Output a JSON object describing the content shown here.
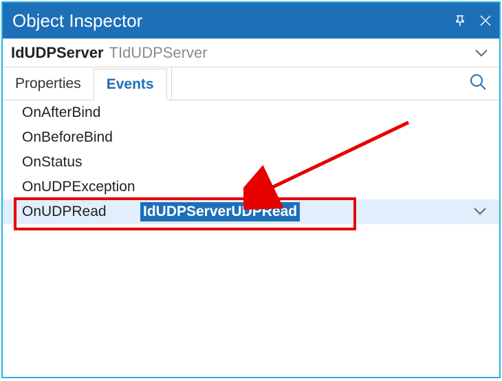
{
  "titlebar": {
    "title": "Object Inspector"
  },
  "object": {
    "name": "IdUDPServer",
    "type": "TIdUDPServer"
  },
  "tabs": {
    "properties": "Properties",
    "events": "Events",
    "active": "events"
  },
  "search": {
    "value": "",
    "placeholder": ""
  },
  "events": [
    {
      "name": "OnAfterBind",
      "value": ""
    },
    {
      "name": "OnBeforeBind",
      "value": ""
    },
    {
      "name": "OnStatus",
      "value": ""
    },
    {
      "name": "OnUDPException",
      "value": ""
    },
    {
      "name": "OnUDPRead",
      "value": "IdUDPServerUDPRead",
      "selected": true
    }
  ],
  "colors": {
    "accent": "#1d6fb8",
    "annotation": "#e60000",
    "frame": "#22b3e6"
  }
}
